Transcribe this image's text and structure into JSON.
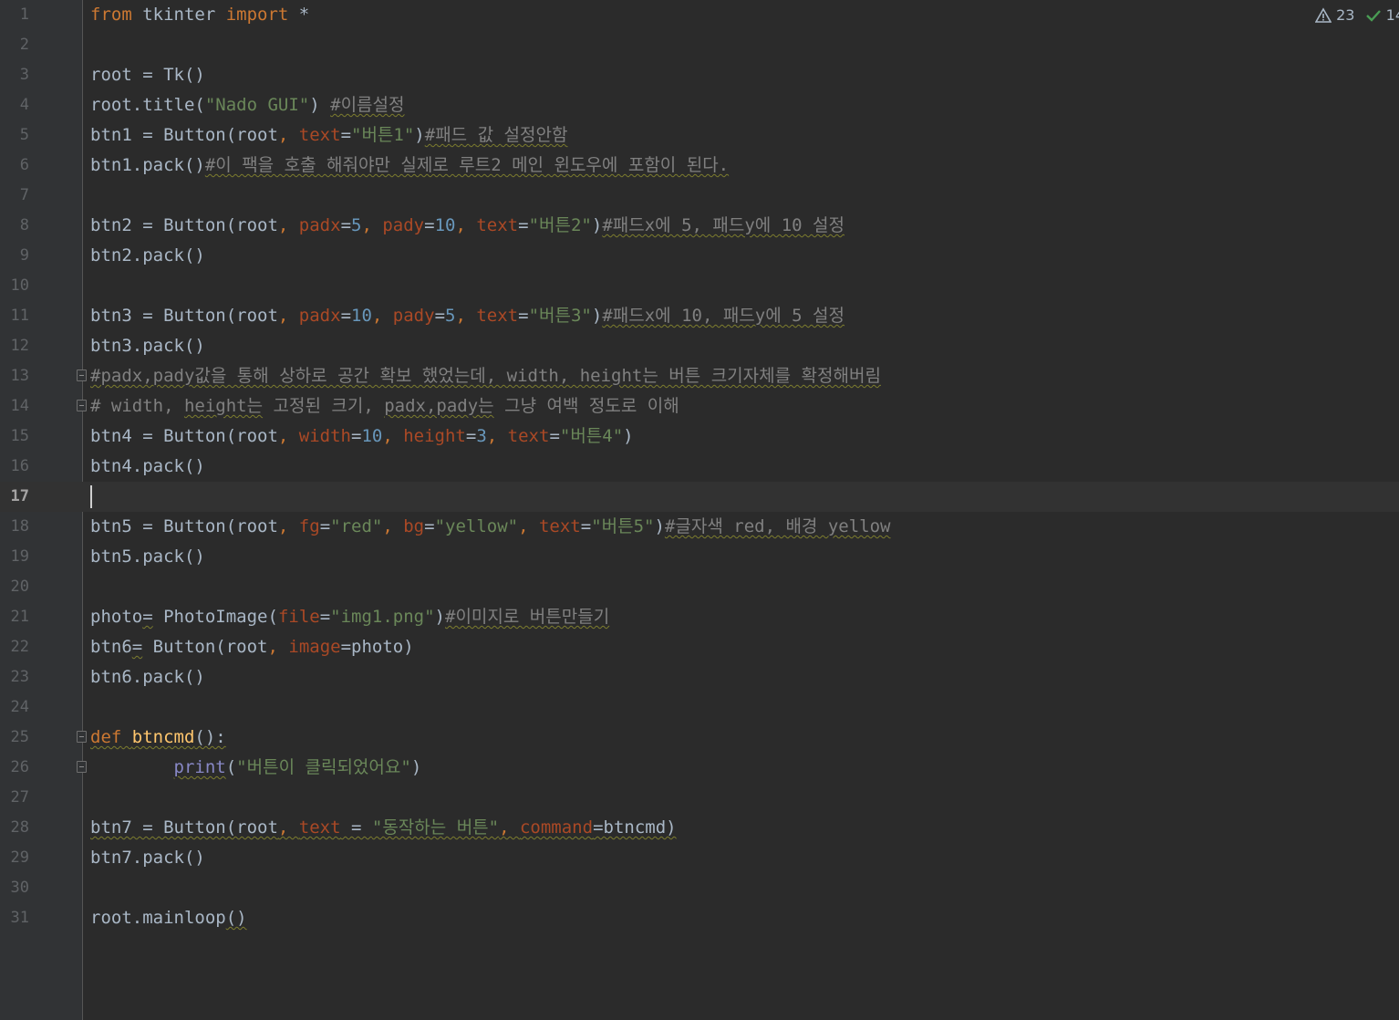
{
  "inspection": {
    "warnings_count": "23",
    "ok_count": "14"
  },
  "colors": {
    "background": "#2b2b2b",
    "keyword": "#cc7832",
    "string": "#6a8759",
    "number": "#6897bb",
    "comment": "#808080",
    "parameter": "#aa4926",
    "function": "#ffc66d"
  },
  "editor": {
    "current_line": 17,
    "lines": [
      {
        "n": "1",
        "t": [
          "from",
          " tkinter ",
          "import",
          " *"
        ]
      },
      {
        "n": "2",
        "t": []
      },
      {
        "n": "3",
        "t": [
          "root = Tk()"
        ]
      },
      {
        "n": "4",
        "t": [
          "root.title(",
          "\"Nado GUI\"",
          ") ",
          "#이름설정"
        ]
      },
      {
        "n": "5",
        "t": [
          "btn1 = Button(root",
          ", ",
          "text",
          "=",
          "\"버튼1\"",
          ")",
          "#패드 값 설정안함"
        ]
      },
      {
        "n": "6",
        "t": [
          "btn1.pack()",
          "#이 팩을 호출 해줘야만 실제로 루트2 메인 윈도우에 포함이 된다."
        ]
      },
      {
        "n": "7",
        "t": []
      },
      {
        "n": "8",
        "t": [
          "btn2 = Button(root",
          ", ",
          "padx",
          "=",
          "5",
          ", ",
          "pady",
          "=",
          "10",
          ", ",
          "text",
          "=",
          "\"버튼2\"",
          ")",
          "#패드x에 5, 패드y에 10 설정"
        ]
      },
      {
        "n": "9",
        "t": [
          "btn2.pack()"
        ]
      },
      {
        "n": "10",
        "t": []
      },
      {
        "n": "11",
        "t": [
          "btn3 = Button(root",
          ", ",
          "padx",
          "=",
          "10",
          ", ",
          "pady",
          "=",
          "5",
          ", ",
          "text",
          "=",
          "\"버튼3\"",
          ")",
          "#패드x에 10, 패드y에 5 설정"
        ]
      },
      {
        "n": "12",
        "t": [
          "btn3.pack()"
        ]
      },
      {
        "n": "13",
        "t": [
          "#padx,pady값을 통해 상하로 공간 확보 했었는데, width, height는 버튼 크기자체를 확정해버림"
        ]
      },
      {
        "n": "14",
        "t": [
          "# width, ",
          "height는",
          " 고정된 크기, ",
          "padx,pady는",
          " 그냥 여백 정도로 이해"
        ]
      },
      {
        "n": "15",
        "t": [
          "btn4 = Button(root",
          ", ",
          "width",
          "=",
          "10",
          ", ",
          "height",
          "=",
          "3",
          ", ",
          "text",
          "=",
          "\"버튼4\"",
          ")"
        ]
      },
      {
        "n": "16",
        "t": [
          "btn4.pack()"
        ]
      },
      {
        "n": "17",
        "t": []
      },
      {
        "n": "18",
        "t": [
          "btn5 = Button(root",
          ", ",
          "fg",
          "=",
          "\"red\"",
          ", ",
          "bg",
          "=",
          "\"yellow\"",
          ", ",
          "text",
          "=",
          "\"버튼5\"",
          ")",
          "#글자색 red, 배경 yellow"
        ]
      },
      {
        "n": "19",
        "t": [
          "btn5.pack()"
        ]
      },
      {
        "n": "20",
        "t": []
      },
      {
        "n": "21",
        "t": [
          "photo",
          "=",
          " PhotoImage(",
          "file",
          "=",
          "\"img1.png\"",
          ")",
          "#이미지로 버튼만들기"
        ]
      },
      {
        "n": "22",
        "t": [
          "btn6",
          "=",
          " Button(root",
          ", ",
          "image",
          "=photo)"
        ]
      },
      {
        "n": "23",
        "t": [
          "btn6.pack()"
        ]
      },
      {
        "n": "24",
        "t": []
      },
      {
        "n": "25",
        "t": [
          "def",
          " ",
          "btncmd",
          "():"
        ]
      },
      {
        "n": "26",
        "t": [
          "        ",
          "print",
          "(",
          "\"버튼이 클릭되었어요\"",
          ")"
        ]
      },
      {
        "n": "27",
        "t": []
      },
      {
        "n": "28",
        "t": [
          "btn7 = Button(root",
          ", ",
          "text",
          " = ",
          "\"동작하는 버튼\"",
          ", ",
          "command",
          "=btncmd)"
        ]
      },
      {
        "n": "29",
        "t": [
          "btn7.pack()"
        ]
      },
      {
        "n": "30",
        "t": []
      },
      {
        "n": "31",
        "t": [
          "root.mainloop",
          "()"
        ]
      }
    ]
  }
}
